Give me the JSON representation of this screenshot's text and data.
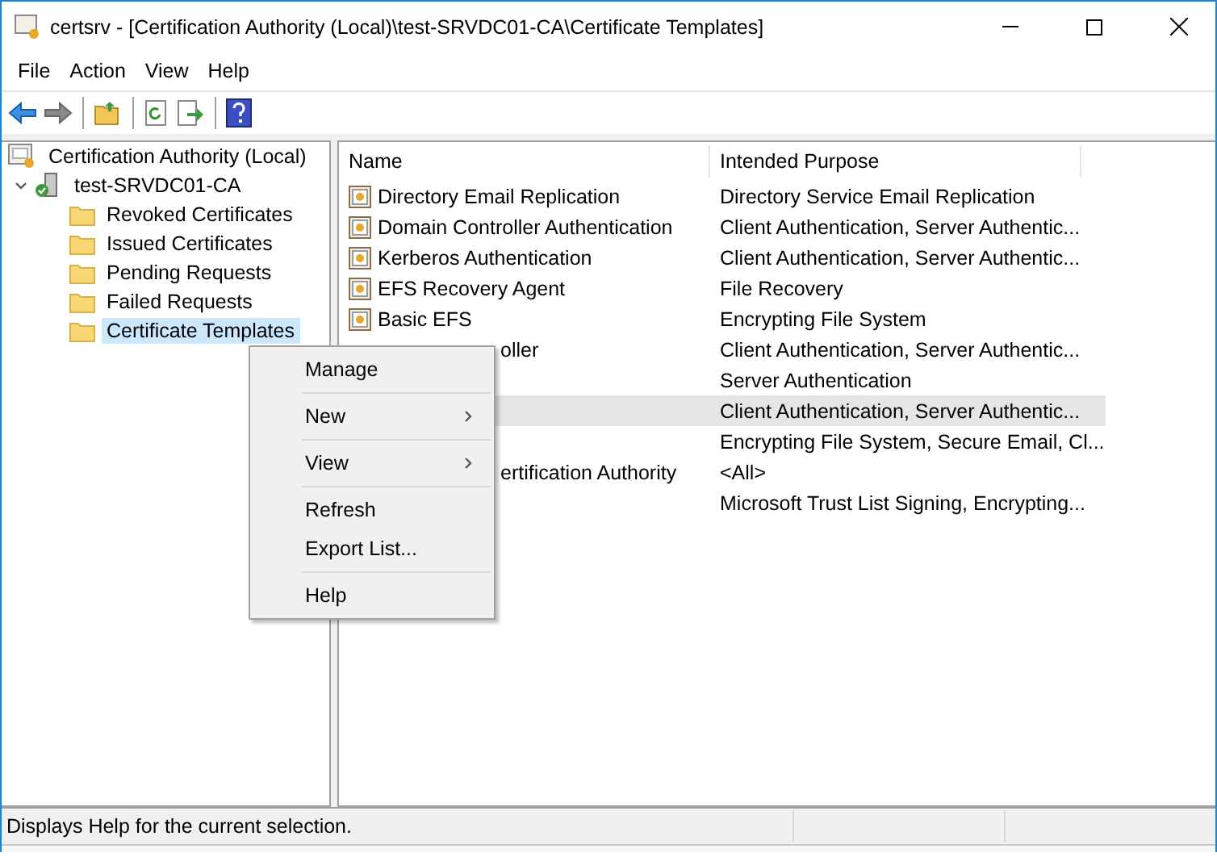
{
  "window": {
    "title": "certsrv - [Certification Authority (Local)\\test-SRVDC01-CA\\Certificate Templates]"
  },
  "menu_bar": [
    "File",
    "Action",
    "View",
    "Help"
  ],
  "tree": {
    "label": "Certification Authority (Local)",
    "children": [
      {
        "label": "test-SRVDC01-CA",
        "expanded": true,
        "children": [
          {
            "label": "Revoked Certificates",
            "selected": false
          },
          {
            "label": "Issued Certificates",
            "selected": false
          },
          {
            "label": "Pending Requests",
            "selected": false
          },
          {
            "label": "Failed Requests",
            "selected": false
          },
          {
            "label": "Certificate Templates",
            "selected": true
          }
        ]
      }
    ]
  },
  "table": {
    "columns": [
      "Name",
      "Intended Purpose"
    ],
    "rows": [
      {
        "kind": "template",
        "name": "Directory Email Replication",
        "purpose": "Directory Service Email Replication",
        "selected": false
      },
      {
        "kind": "template",
        "name": "Domain Controller Authentication",
        "purpose": "Client Authentication, Server Authentic...",
        "selected": false
      },
      {
        "kind": "template",
        "name": "Kerberos Authentication",
        "purpose": "Client Authentication, Server Authentic...",
        "selected": false
      },
      {
        "kind": "template",
        "name": "EFS Recovery Agent",
        "purpose": "File Recovery",
        "selected": false
      },
      {
        "kind": "template",
        "name": "Basic EFS",
        "purpose": "Encrypting File System",
        "selected": false
      },
      {
        "kind": "hidden",
        "name": "oller",
        "purpose": "Client Authentication, Server Authentic...",
        "selected": false
      },
      {
        "kind": "hidden",
        "purpose": "Server Authentication",
        "selected": false
      },
      {
        "kind": "hidden",
        "purpose": "Client Authentication, Server Authentic...",
        "selected": true
      },
      {
        "kind": "hidden",
        "purpose": "Encrypting File System, Secure Email, Cl...",
        "selected": false
      },
      {
        "kind": "hidden",
        "name": "ertification Authority",
        "purpose": "<All>",
        "selected": false
      },
      {
        "kind": "hidden",
        "purpose": "Microsoft Trust List Signing, Encrypting...",
        "selected": false
      }
    ]
  },
  "context_menu": [
    {
      "kind": "item",
      "label": "Manage"
    },
    {
      "kind": "separator"
    },
    {
      "kind": "submenu",
      "label": "New"
    },
    {
      "kind": "separator"
    },
    {
      "kind": "submenu",
      "label": "View"
    },
    {
      "kind": "separator"
    },
    {
      "kind": "item",
      "label": "Refresh"
    },
    {
      "kind": "item",
      "label": "Export List..."
    },
    {
      "kind": "separator"
    },
    {
      "kind": "item",
      "label": "Help"
    }
  ],
  "status_bar": "Displays Help for the current selection."
}
